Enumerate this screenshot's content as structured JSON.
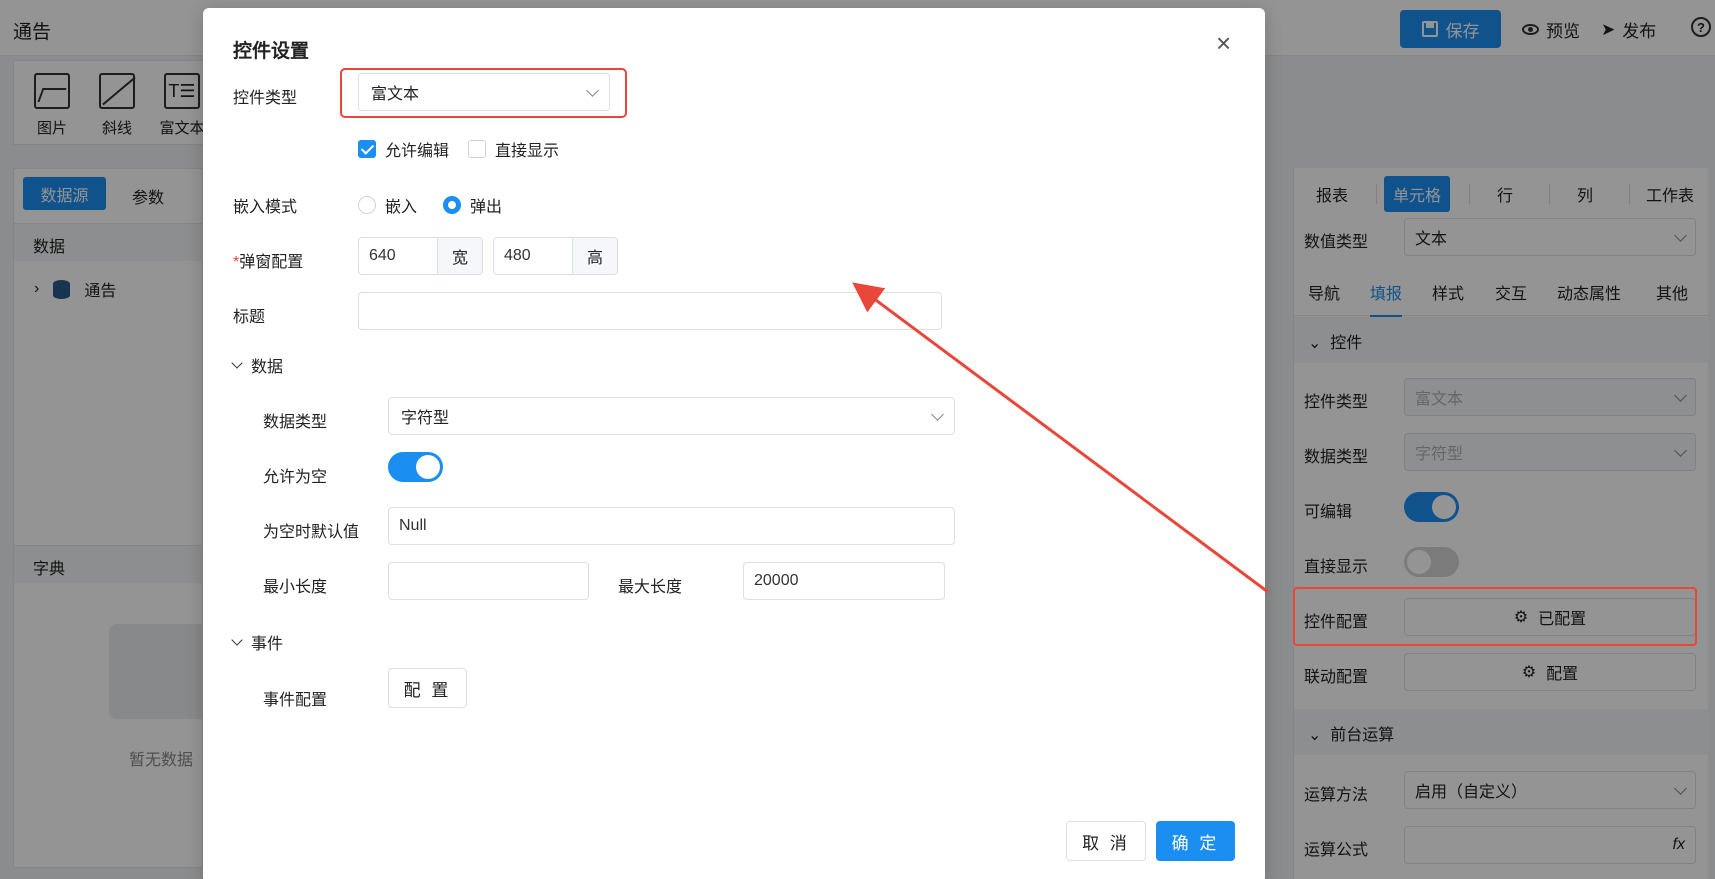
{
  "app": {
    "title": "通告"
  },
  "topbar": {
    "save_label": "保存",
    "preview_label": "预览",
    "publish_label": "发布",
    "help_label": "?"
  },
  "toolbox": {
    "items": [
      "图片",
      "斜线",
      "富文本"
    ],
    "richtext_glyph": "T☰"
  },
  "left_panel": {
    "tab_datasource": "数据源",
    "tab_params": "参数",
    "section_data": "数据",
    "tree_item": "通告",
    "section_dict": "字典",
    "empty_text": "暂无数据"
  },
  "right_panel": {
    "tabs": [
      "报表",
      "单元格",
      "行",
      "列",
      "工作表"
    ],
    "active_tab": "单元格",
    "value_type_label": "数值类型",
    "value_type_value": "文本",
    "subtabs": [
      "导航",
      "填报",
      "样式",
      "交互",
      "动态属性",
      "其他"
    ],
    "active_subtab": "填报",
    "group_control": "控件",
    "control_type_label": "控件类型",
    "control_type_value": "富文本",
    "data_type_label": "数据类型",
    "data_type_value": "字符型",
    "editable_label": "可编辑",
    "editable_on": true,
    "direct_display_label": "直接显示",
    "direct_display_on": false,
    "control_config_label": "控件配置",
    "control_config_btn": "已配置",
    "linkage_config_label": "联动配置",
    "linkage_config_btn": "配置",
    "group_frontend": "前台运算",
    "calc_method_label": "运算方法",
    "calc_method_value": "启用（自定义）",
    "calc_formula_label": "运算公式",
    "fx_icon": "fx"
  },
  "modal": {
    "title": "控件设置",
    "close": "×",
    "control_type_label": "控件类型",
    "control_type_value": "富文本",
    "allow_edit_label": "允许编辑",
    "allow_edit_checked": true,
    "direct_display_label": "直接显示",
    "direct_display_checked": false,
    "embed_mode_label": "嵌入模式",
    "embed_option": "嵌入",
    "popup_option": "弹出",
    "embed_mode_value": "弹出",
    "popup_config_required": "*",
    "popup_config_label": "弹窗配置",
    "popup_width": "640",
    "width_unit": "宽",
    "popup_height": "480",
    "height_unit": "高",
    "title_label": "标题",
    "title_value": "",
    "section_data": "数据",
    "data_type_label": "数据类型",
    "data_type_value": "字符型",
    "allow_empty_label": "允许为空",
    "allow_empty_on": true,
    "empty_default_label": "为空时默认值",
    "empty_default_value": "Null",
    "min_length_label": "最小长度",
    "min_length_value": "",
    "max_length_label": "最大长度",
    "max_length_value": "20000",
    "section_event": "事件",
    "event_config_label": "事件配置",
    "event_config_btn": "配 置",
    "cancel_btn": "取 消",
    "confirm_btn": "确 定"
  },
  "colors": {
    "accent": "#1b8ef2",
    "highlight": "#e8473a"
  }
}
